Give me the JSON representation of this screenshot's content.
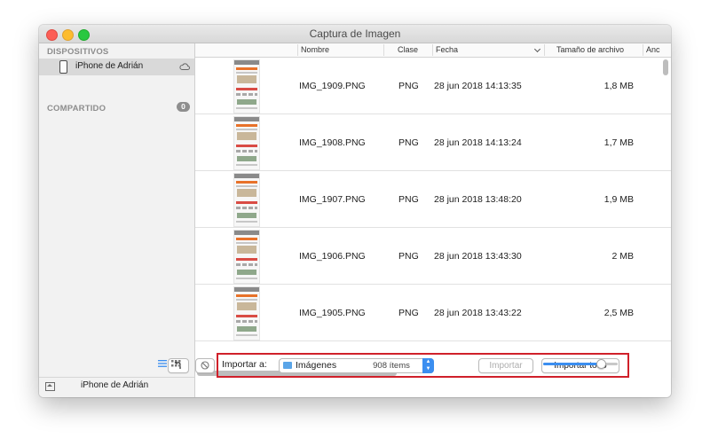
{
  "window": {
    "title": "Captura de Imagen"
  },
  "sidebar": {
    "devices_title": "DISPOSITIVOS",
    "device_name": "iPhone de Adrián",
    "shared_title": "COMPARTIDO",
    "shared_count": "0",
    "bottom_device": "iPhone de Adrián"
  },
  "columns": {
    "name": "Nombre",
    "kind": "Clase",
    "date": "Fecha",
    "size": "Tamaño de archivo",
    "width": "Anc"
  },
  "rows": [
    {
      "name": "IMG_1909.PNG",
      "kind": "PNG",
      "date": "28 jun 2018 14:13:35",
      "size": "1,8 MB"
    },
    {
      "name": "IMG_1908.PNG",
      "kind": "PNG",
      "date": "28 jun 2018 14:13:24",
      "size": "1,7 MB"
    },
    {
      "name": "IMG_1907.PNG",
      "kind": "PNG",
      "date": "28 jun 2018 13:48:20",
      "size": "1,9 MB"
    },
    {
      "name": "IMG_1906.PNG",
      "kind": "PNG",
      "date": "28 jun 2018 13:43:30",
      "size": "2 MB"
    },
    {
      "name": "IMG_1905.PNG",
      "kind": "PNG",
      "date": "28 jun 2018 13:43:22",
      "size": "2,5 MB"
    }
  ],
  "toolbar": {
    "import_to_label": "Importar a:",
    "destination": "Imágenes",
    "import_label": "Importar",
    "import_all_label": "Importar todo"
  },
  "status": {
    "item_count": "908 ítems"
  },
  "icons": {
    "rotate": "rotate-left-icon",
    "delete": "no-entry-icon",
    "folder": "folder-icon",
    "cloud": "cloud-icon",
    "phone": "iphone-icon",
    "list_view": "list-view-icon",
    "grid_view": "grid-view-icon"
  },
  "colors": {
    "accent": "#3b8ef0",
    "highlight_box": "#d0202a",
    "folder": "#5aa5e8"
  },
  "thumbnail_zoom": 0.75
}
